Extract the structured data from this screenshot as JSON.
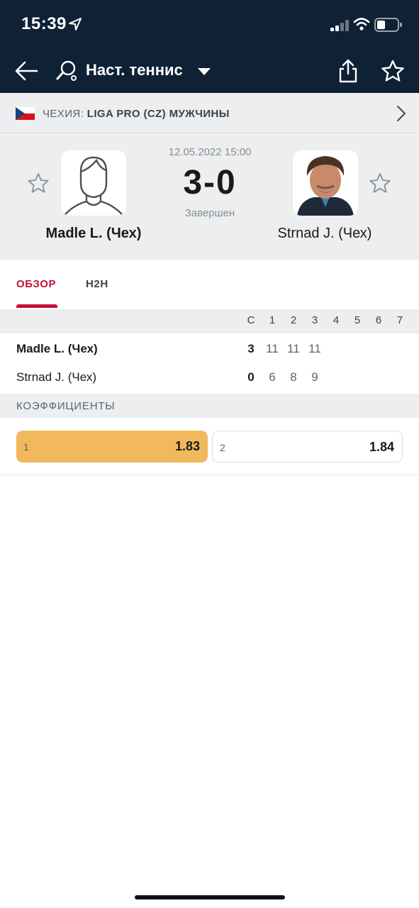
{
  "status_bar": {
    "time": "15:39"
  },
  "header": {
    "sport_title": "Наст. теннис"
  },
  "league": {
    "country": "ЧЕХИЯ:",
    "name": "LIGA PRO (CZ) МУЖЧИНЫ"
  },
  "match": {
    "date": "12.05.2022 15:00",
    "score": "3-0",
    "status": "Завершен",
    "home": {
      "name": "Madle L. (Чех)"
    },
    "away": {
      "name": "Strnad J. (Чех)"
    }
  },
  "tabs": [
    {
      "label": "ОБЗОР"
    },
    {
      "label": "H2H"
    }
  ],
  "score_table": {
    "columns": [
      "С",
      "1",
      "2",
      "3",
      "4",
      "5",
      "6",
      "7"
    ],
    "rows": [
      {
        "name": "Madle L. (Чех)",
        "total": "3",
        "sets": [
          "11",
          "11",
          "11"
        ]
      },
      {
        "name": "Strnad J. (Чех)",
        "total": "0",
        "sets": [
          "6",
          "8",
          "9"
        ]
      }
    ]
  },
  "odds": {
    "title": "КОЭФФИЦИЕНТЫ",
    "items": [
      {
        "label": "1",
        "value": "1.83"
      },
      {
        "label": "2",
        "value": "1.84"
      }
    ]
  },
  "colors": {
    "topbar": "#0f2135",
    "accent": "#c8103a",
    "odd_highlight": "#f2b85c"
  }
}
